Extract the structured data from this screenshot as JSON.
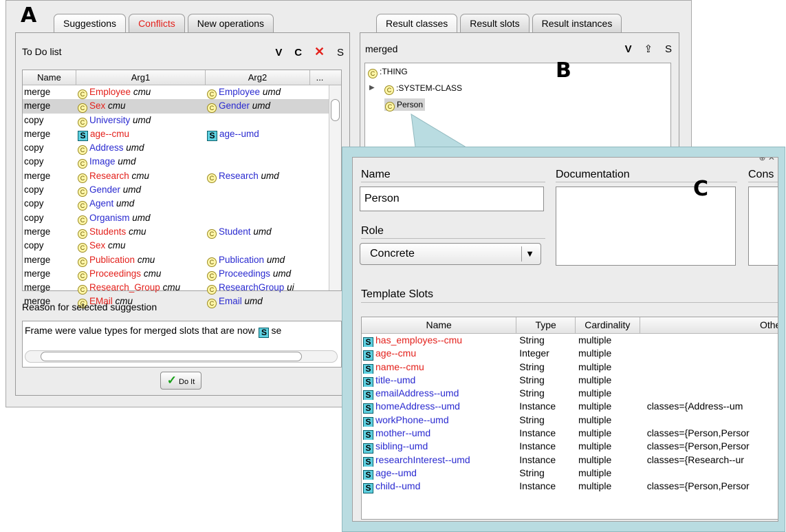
{
  "labels": {
    "a": "A",
    "b": "B",
    "c": "C"
  },
  "left": {
    "tabs": [
      {
        "label": "Suggestions",
        "color": "#000000"
      },
      {
        "label": "Conflicts",
        "color": "#e3201b"
      },
      {
        "label": "New operations",
        "color": "#000000"
      }
    ],
    "todo_title": "To Do list",
    "toolbar": {
      "v": "V",
      "c": "C",
      "x": "✕",
      "s": "S"
    },
    "columns": [
      "Name",
      "Arg1",
      "Arg2",
      "..."
    ],
    "rows": [
      {
        "op": "merge",
        "a1": {
          "icon": "C",
          "name": "Employee",
          "color": "red",
          "ns": "cmu"
        },
        "a2": {
          "icon": "C",
          "name": "Employee",
          "color": "blue",
          "ns": "umd"
        }
      },
      {
        "op": "merge",
        "a1": {
          "icon": "C",
          "name": "Sex",
          "color": "red",
          "ns": "cmu"
        },
        "a2": {
          "icon": "C",
          "name": "Gender",
          "color": "blue",
          "ns": "umd"
        },
        "selected": true
      },
      {
        "op": "copy",
        "a1": {
          "icon": "C",
          "name": "University",
          "color": "blue",
          "ns": "umd"
        }
      },
      {
        "op": "merge",
        "a1": {
          "icon": "S",
          "name": "age--cmu",
          "color": "red",
          "ns": ""
        },
        "a2": {
          "icon": "S",
          "name": "age--umd",
          "color": "blue",
          "ns": ""
        }
      },
      {
        "op": "copy",
        "a1": {
          "icon": "C",
          "name": "Address",
          "color": "blue",
          "ns": "umd"
        }
      },
      {
        "op": "copy",
        "a1": {
          "icon": "C",
          "name": "Image",
          "color": "blue",
          "ns": "umd"
        }
      },
      {
        "op": "merge",
        "a1": {
          "icon": "C",
          "name": "Research",
          "color": "red",
          "ns": "cmu"
        },
        "a2": {
          "icon": "C",
          "name": "Research",
          "color": "blue",
          "ns": "umd"
        }
      },
      {
        "op": "copy",
        "a1": {
          "icon": "C",
          "name": "Gender",
          "color": "blue",
          "ns": "umd"
        }
      },
      {
        "op": "copy",
        "a1": {
          "icon": "C",
          "name": "Agent",
          "color": "blue",
          "ns": "umd"
        }
      },
      {
        "op": "copy",
        "a1": {
          "icon": "C",
          "name": "Organism",
          "color": "blue",
          "ns": "umd"
        }
      },
      {
        "op": "merge",
        "a1": {
          "icon": "C",
          "name": "Students",
          "color": "red",
          "ns": "cmu"
        },
        "a2": {
          "icon": "C",
          "name": "Student",
          "color": "blue",
          "ns": "umd"
        }
      },
      {
        "op": "copy",
        "a1": {
          "icon": "C",
          "name": "Sex",
          "color": "red",
          "ns": "cmu"
        }
      },
      {
        "op": "merge",
        "a1": {
          "icon": "C",
          "name": "Publication",
          "color": "red",
          "ns": "cmu"
        },
        "a2": {
          "icon": "C",
          "name": "Publication",
          "color": "blue",
          "ns": "umd"
        }
      },
      {
        "op": "merge",
        "a1": {
          "icon": "C",
          "name": "Proceedings",
          "color": "red",
          "ns": "cmu"
        },
        "a2": {
          "icon": "C",
          "name": "Proceedings",
          "color": "blue",
          "ns": "umd"
        }
      },
      {
        "op": "merge",
        "a1": {
          "icon": "C",
          "name": "Research_Group",
          "color": "red",
          "ns": "cmu"
        },
        "a2": {
          "icon": "C",
          "name": "ResearchGroup",
          "color": "blue",
          "ns": "ui"
        }
      },
      {
        "op": "merge",
        "a1": {
          "icon": "C",
          "name": "EMail",
          "color": "red",
          "ns": "cmu"
        },
        "a2": {
          "icon": "C",
          "name": "Email",
          "color": "blue",
          "ns": "umd"
        }
      }
    ],
    "reason_title": "Reason for selected suggestion",
    "reason_text": "Frame were value types for merged slots that are now",
    "reason_tail": "se",
    "do_it": "Do It"
  },
  "right": {
    "tabs": [
      "Result classes",
      "Result slots",
      "Result instances"
    ],
    "header": "merged",
    "toolbar": {
      "v": "V",
      "up": "⇪",
      "s": "S"
    },
    "tree": [
      {
        "label": ":THING",
        "depth": 0,
        "arrow": false
      },
      {
        "label": ":SYSTEM-CLASS",
        "depth": 1,
        "arrow": true
      },
      {
        "label": "Person",
        "depth": 1,
        "arrow": false,
        "selected": true
      }
    ]
  },
  "detail": {
    "name_label": "Name",
    "name_value": "Person",
    "doc_label": "Documentation",
    "cons_label": "Cons",
    "role_label": "Role",
    "role_value": "Concrete",
    "template_label": "Template Slots",
    "columns": [
      "Name",
      "Type",
      "Cardinality",
      "Other"
    ],
    "slots": [
      {
        "name": "has_employes--cmu",
        "color": "red",
        "type": "String",
        "card": "multiple",
        "other": ""
      },
      {
        "name": "age--cmu",
        "color": "red",
        "type": "Integer",
        "card": "multiple",
        "other": ""
      },
      {
        "name": "name--cmu",
        "color": "red",
        "type": "String",
        "card": "multiple",
        "other": ""
      },
      {
        "name": "title--umd",
        "color": "blue",
        "type": "String",
        "card": "multiple",
        "other": ""
      },
      {
        "name": "emailAddress--umd",
        "color": "blue",
        "type": "String",
        "card": "multiple",
        "other": ""
      },
      {
        "name": "homeAddress--umd",
        "color": "blue",
        "type": "Instance",
        "card": "multiple",
        "other": "classes={Address--um"
      },
      {
        "name": "workPhone--umd",
        "color": "blue",
        "type": "String",
        "card": "multiple",
        "other": ""
      },
      {
        "name": "mother--umd",
        "color": "blue",
        "type": "Instance",
        "card": "multiple",
        "other": "classes={Person,Persor"
      },
      {
        "name": "sibling--umd",
        "color": "blue",
        "type": "Instance",
        "card": "multiple",
        "other": "classes={Person,Persor"
      },
      {
        "name": "researchInterest--umd",
        "color": "blue",
        "type": "Instance",
        "card": "multiple",
        "other": "classes={Research--ur"
      },
      {
        "name": "age--umd",
        "color": "blue",
        "type": "String",
        "card": "multiple",
        "other": ""
      },
      {
        "name": "child--umd",
        "color": "blue",
        "type": "Instance",
        "card": "multiple",
        "other": "classes={Person,Persor"
      }
    ]
  },
  "colors": {
    "red": "#e3201b",
    "blue": "#2a2ad0",
    "cyan_icon": "#5ed0e0",
    "class_icon": "#fff6a8",
    "callout": "#b9dce1"
  }
}
